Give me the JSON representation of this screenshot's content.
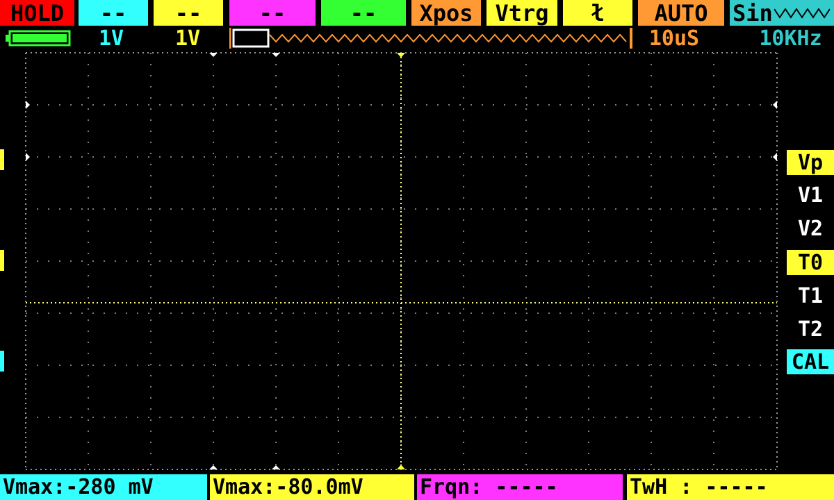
{
  "top_bar": {
    "hold": "HOLD",
    "ch_a": "--",
    "ch_b": "--",
    "ch_c": "--",
    "ch_d": "--",
    "xpos": "Xpos",
    "vtrg": "Vtrg",
    "trig_edge": "ł",
    "mode": "AUTO",
    "wave": "Sin"
  },
  "status_row": {
    "ch_a_scale": "1V",
    "ch_b_scale": "1V",
    "timebase": "10uS",
    "frequency": "10KHz"
  },
  "side_menu": {
    "items": [
      "Vp",
      "V1",
      "V2",
      "T0",
      "T1",
      "T2",
      "CAL"
    ]
  },
  "bottom_bar": {
    "m1": "Vmax:-280 mV",
    "m2": "Vmax:-80.0mV",
    "m3": "Frqn: -----",
    "m4": "TwH : -----"
  },
  "colors": {
    "red": "#ff0000",
    "cyan": "#33ffff",
    "yellow": "#ffff33",
    "magenta": "#ff33ff",
    "green": "#33ff33",
    "orange": "#ff9933",
    "teal": "#33cccc",
    "grid": "#cccccc"
  }
}
